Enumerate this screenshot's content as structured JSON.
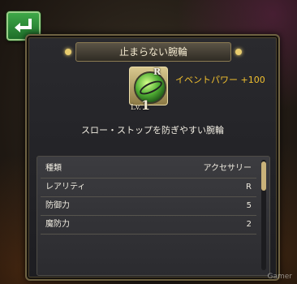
{
  "item": {
    "name": "止まらない腕輪",
    "rarity": "R",
    "level_prefix": "Lv.",
    "level": "1",
    "event_power": "イベントパワー +100",
    "description": "スロー・ストップを防ぎやすい腕輪"
  },
  "stats": [
    {
      "label": "種類",
      "value": "アクセサリー"
    },
    {
      "label": "レアリティ",
      "value": "R"
    },
    {
      "label": "防御力",
      "value": "5"
    },
    {
      "label": "魔防力",
      "value": "2"
    }
  ],
  "watermark": "Gamer",
  "colors": {
    "accent_gold": "#f2c12f",
    "back_button": "#2f8a3a",
    "frame": "#6e6242"
  },
  "icons": {
    "back": "return-arrow-icon",
    "item": "bracelet-icon"
  }
}
